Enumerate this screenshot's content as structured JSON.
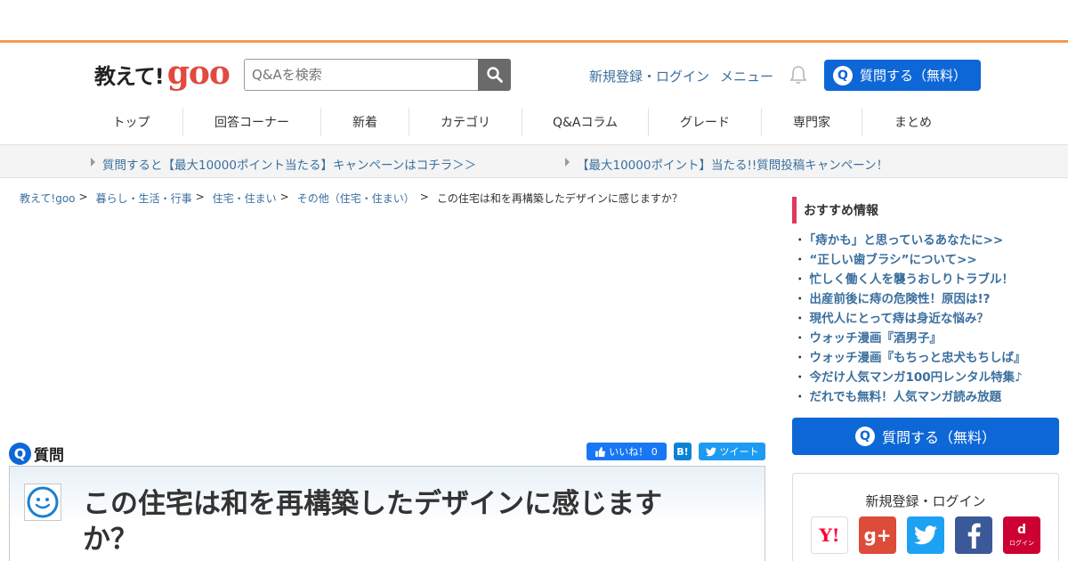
{
  "header": {
    "logo_text": "教えて!",
    "logo_goo": "goo",
    "search_placeholder": "Q&Aを検索",
    "register_login": "新規登録・ログイン",
    "menu": "メニュー",
    "ask_button": "質問する（無料）",
    "ask_q": "Q"
  },
  "nav": {
    "items": [
      "トップ",
      "回答コーナー",
      "新着",
      "カテゴリ",
      "Q&Aコラム",
      "グレード",
      "専門家",
      "まとめ"
    ]
  },
  "campaigns": [
    "質問すると【最大10000ポイント当たる】キャンペーンはコチラ＞＞",
    "【最大10000ポイント】当たる!!質問投稿キャンペーン！"
  ],
  "breadcrumb": {
    "items": [
      "教えて!goo",
      "暮らし・生活・行事",
      "住宅・住まい",
      "その他（住宅・住まい）"
    ],
    "separator": ">",
    "current": "この住宅は和を再構築したデザインに感じますか？"
  },
  "question": {
    "badge": "Q",
    "label": "質問",
    "title": "この住宅は和を再構築したデザインに感じますか？"
  },
  "share": {
    "like": "いいね！ 0",
    "hatena": "B!",
    "tweet": "ツイート"
  },
  "sidebar": {
    "recommend_heading": "おすすめ情報",
    "bullet": "・",
    "recommend_items": [
      "「痔かも」と思っているあなたに>>",
      "“正しい歯ブラシ”について>>",
      "忙しく働く人を襲うおしりトラブル！",
      "出産前後に痔の危険性！原因は!?",
      "現代人にとって痔は身近な悩み？",
      "ウォッチ漫画『酒男子』",
      "ウォッチ漫画『もちっと忠犬もちしば』",
      "今だけ人気マンガ100円レンタル特集♪",
      "だれでも無料！人気マンガ読み放題"
    ],
    "ask_button": "質問する（無料）",
    "login_title": "新規登録・ログイン",
    "social": {
      "yahoo": "Y!",
      "gplus": "g+",
      "docomo_mark": "d",
      "docomo_label": "ログイン"
    }
  },
  "colors": {
    "accent_blue": "#0e67d6",
    "link_blue": "#3b6f9e",
    "orange_rule": "#f39a53",
    "pink_bar": "#e2375c"
  }
}
